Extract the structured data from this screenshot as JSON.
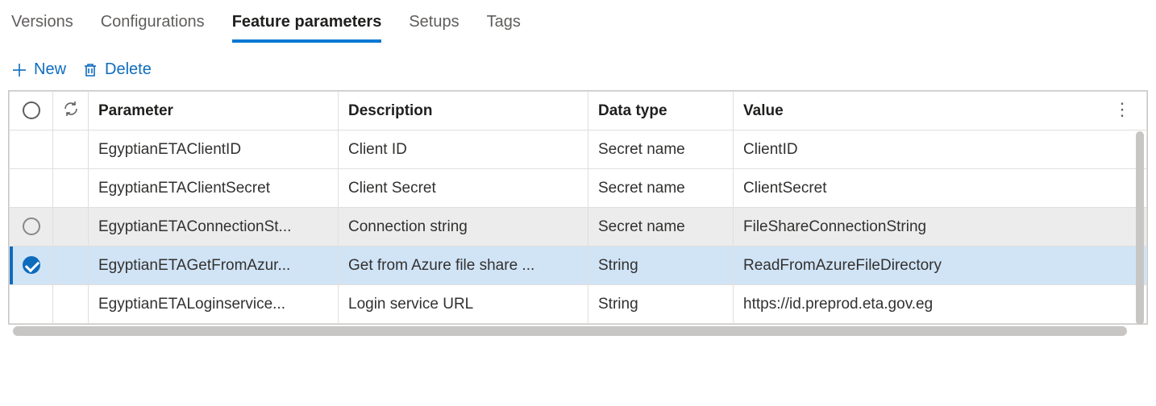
{
  "tabs": {
    "items": [
      {
        "label": "Versions",
        "active": false
      },
      {
        "label": "Configurations",
        "active": false
      },
      {
        "label": "Feature parameters",
        "active": true
      },
      {
        "label": "Setups",
        "active": false
      },
      {
        "label": "Tags",
        "active": false
      }
    ]
  },
  "commands": {
    "new": "New",
    "delete": "Delete"
  },
  "grid": {
    "columns": {
      "parameter": "Parameter",
      "description": "Description",
      "datatype": "Data type",
      "value": "Value"
    },
    "rows": [
      {
        "selected": false,
        "hover": false,
        "parameter": "EgyptianETAClientID",
        "description": "Client ID",
        "datatype": "Secret name",
        "value": "ClientID"
      },
      {
        "selected": false,
        "hover": false,
        "parameter": "EgyptianETAClientSecret",
        "description": "Client Secret",
        "datatype": "Secret name",
        "value": "ClientSecret"
      },
      {
        "selected": false,
        "hover": true,
        "parameter": "EgyptianETAConnectionSt...",
        "description": "Connection string",
        "datatype": "Secret name",
        "value": "FileShareConnectionString"
      },
      {
        "selected": true,
        "hover": false,
        "parameter": "EgyptianETAGetFromAzur...",
        "description": "Get from Azure file share ...",
        "datatype": "String",
        "value": "ReadFromAzureFileDirectory"
      },
      {
        "selected": false,
        "hover": false,
        "parameter": "EgyptianETALoginservice...",
        "description": "Login service URL",
        "datatype": "String",
        "value": "https://id.preprod.eta.gov.eg"
      }
    ]
  }
}
